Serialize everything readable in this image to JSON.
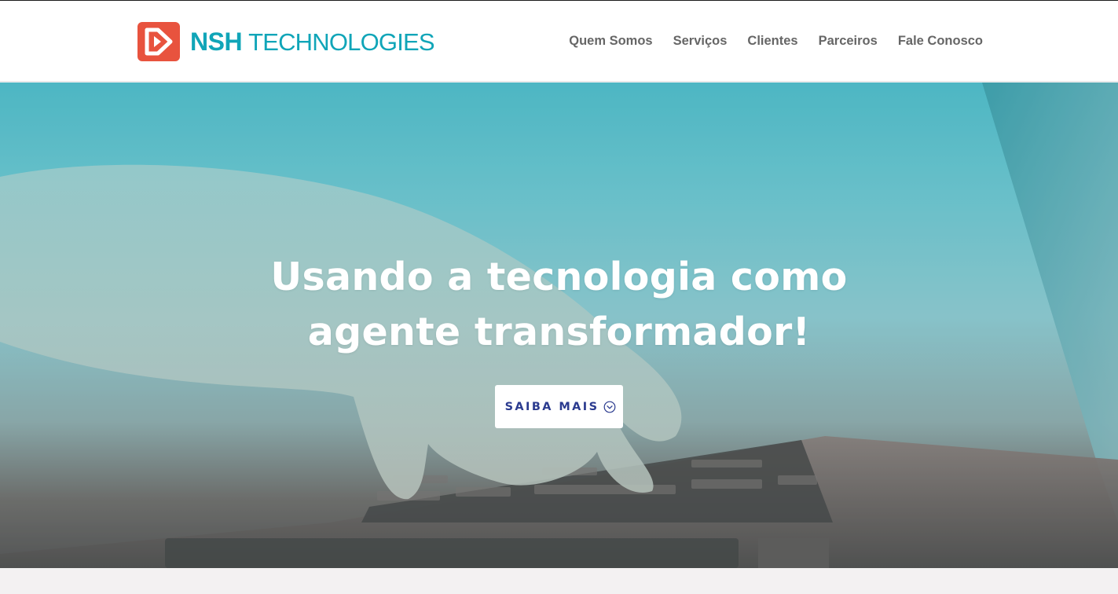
{
  "brand": {
    "name_bold": "NSH",
    "name_rest": "TECHNOLOGIES",
    "logo_icon": "play-arrow-badge-icon",
    "colors": {
      "accent": "#10a5b8",
      "mark": "#e8533e",
      "cta_text": "#2b3b8f"
    }
  },
  "nav": {
    "items": [
      {
        "label": "Quem Somos"
      },
      {
        "label": "Serviços"
      },
      {
        "label": "Clientes"
      },
      {
        "label": "Parceiros"
      },
      {
        "label": "Fale Conosco"
      }
    ]
  },
  "hero": {
    "title_line1": "Usando a tecnologia como",
    "title_line2": "agente transformador!",
    "cta_label": "SAIBA MAIS",
    "cta_icon": "chevron-down-circle-icon",
    "background": "hand-typing-on-laptop-photo"
  }
}
